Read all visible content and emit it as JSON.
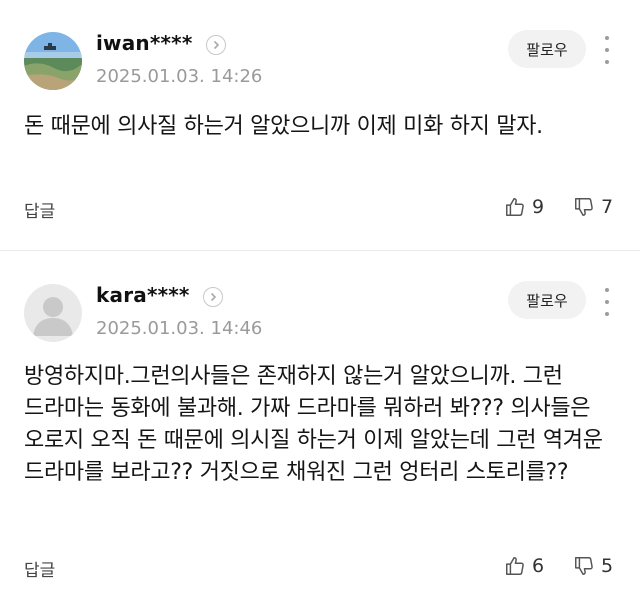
{
  "comments": [
    {
      "username": "iwan****",
      "timestamp": "2025.01.03. 14:26",
      "follow_label": "팔로우",
      "text": "돈 때문에 의사질 하는거 알았으니까 이제 미화 하지 말자.",
      "reply_label": "답글",
      "likes": "9",
      "dislikes": "7",
      "avatar": "landscape-photo"
    },
    {
      "username": "kara****",
      "timestamp": "2025.01.03. 14:46",
      "follow_label": "팔로우",
      "text": "방영하지마.그런의사들은 존재하지 않는거 알았으니까. 그런 드라마는 동화에 불과해. 가짜 드라마를 뭐하러 봐??? 의사들은 오로지 오직 돈 때문에 의시질 하는거 이제 알았는데 그런 역겨운 드라마를 보라고?? 거짓으로 채워진 그런 엉터리 스토리를??",
      "reply_label": "답글",
      "likes": "6",
      "dislikes": "5",
      "avatar": "default-user"
    }
  ],
  "icons": {
    "chevron": "chevron-right-icon",
    "like": "thumbs-up-icon",
    "dislike": "thumbs-down-icon",
    "more": "more-vertical-icon"
  },
  "colors": {
    "follow_bg": "#f2f2f2",
    "timestamp": "#9a9a9a",
    "separator": "#ececec"
  }
}
